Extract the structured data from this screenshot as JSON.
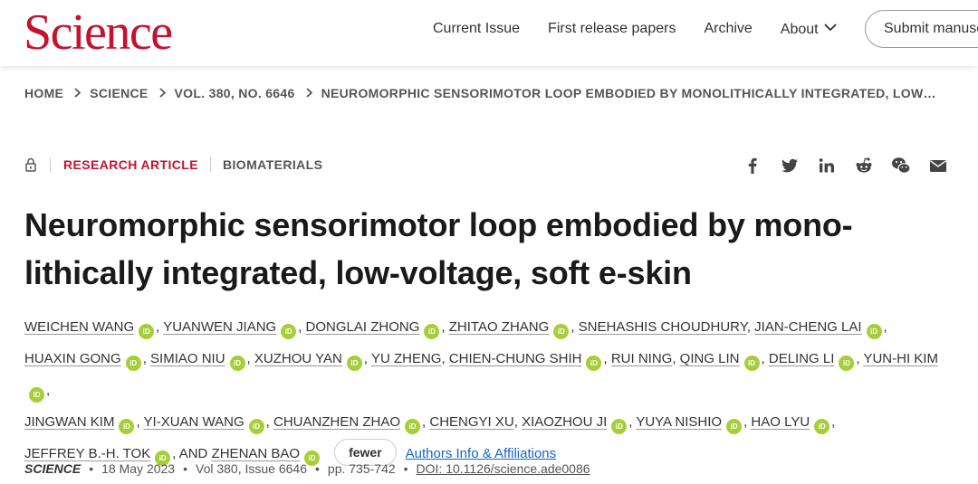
{
  "header": {
    "logo": "Science",
    "nav": [
      "Current Issue",
      "First release papers",
      "Archive",
      "About"
    ],
    "submit_label": "Submit manuscript"
  },
  "breadcrumb": [
    "HOME",
    "SCIENCE",
    "VOL. 380, NO. 6646",
    "NEUROMORPHIC SENSORIMOTOR LOOP EMBODIED BY MONOLITHICALLY INTEGRATED, LOW…"
  ],
  "article": {
    "type": "RESEARCH ARTICLE",
    "subject": "BIOMATERIALS",
    "title": "Neuromorphic sensorimotor loop embodied by mono-lithically integrated, low-voltage, soft e-skin",
    "fewer_label": "fewer",
    "affiliations_label": "Authors Info & Affiliations"
  },
  "share_icons": [
    "facebook-icon",
    "twitter-icon",
    "linkedin-icon",
    "reddit-icon",
    "wechat-icon",
    "email-icon"
  ],
  "authors": [
    {
      "name": "Weichen Wang",
      "orcid": true
    },
    {
      "name": "Yuanwen Jiang",
      "orcid": true
    },
    {
      "name": "Donglai Zhong",
      "orcid": true
    },
    {
      "name": "Zhitao Zhang",
      "orcid": true
    },
    {
      "name": "Snehashis Choudhury",
      "orcid": false
    },
    {
      "name": "Jian-Cheng Lai",
      "orcid": true
    },
    {
      "name": "Huaxin Gong",
      "orcid": true
    },
    {
      "name": "Simiao Niu",
      "orcid": true
    },
    {
      "name": "Xuzhou Yan",
      "orcid": true
    },
    {
      "name": "Yu Zheng",
      "orcid": false
    },
    {
      "name": "Chien-Chung Shih",
      "orcid": true
    },
    {
      "name": "Rui Ning",
      "orcid": false
    },
    {
      "name": "Qing Lin",
      "orcid": true
    },
    {
      "name": "Deling Li",
      "orcid": true
    },
    {
      "name": "Yun-Hi Kim",
      "orcid": true
    },
    {
      "name": "Jingwan Kim",
      "orcid": true
    },
    {
      "name": "Yi-Xuan Wang",
      "orcid": true
    },
    {
      "name": "Chuanzhen Zhao",
      "orcid": true
    },
    {
      "name": "Chengyi Xu",
      "orcid": false
    },
    {
      "name": "Xiaozhou Ji",
      "orcid": true
    },
    {
      "name": "Yuya Nishio",
      "orcid": true
    },
    {
      "name": "Hao Lyu",
      "orcid": true
    },
    {
      "name": "Jeffrey B.-H. Tok",
      "orcid": true
    },
    {
      "name": "Zhenan Bao",
      "orcid": true
    }
  ],
  "citation": {
    "journal": "SCIENCE",
    "date": "18 May 2023",
    "volume": "Vol 380, Issue 6646",
    "pages": "pp. 735-742",
    "doi": "DOI: 10.1126/science.ade0086"
  },
  "colors": {
    "brand": "#c41230",
    "orcid": "#a6ce39",
    "link": "#1565c0"
  }
}
